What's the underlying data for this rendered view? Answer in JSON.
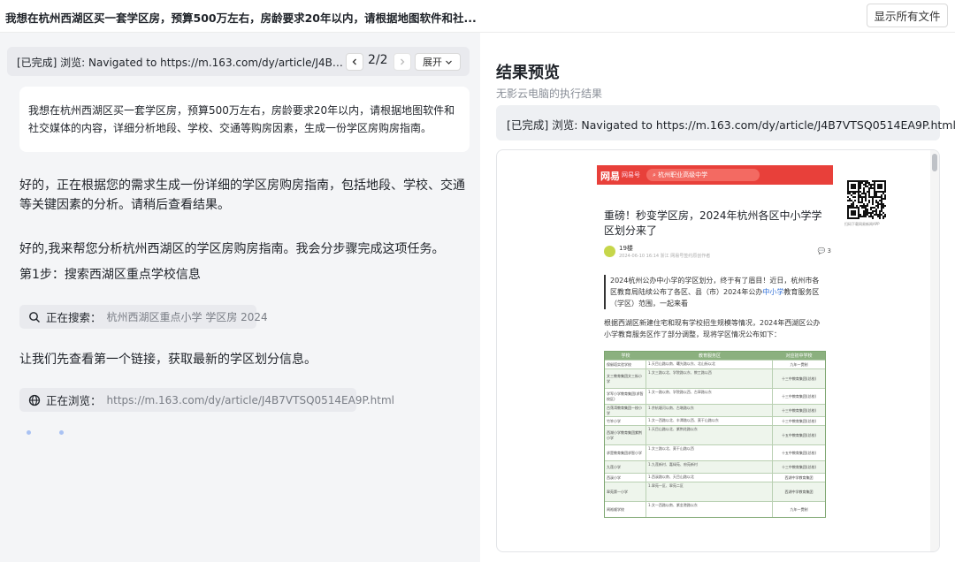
{
  "topbar": {
    "title": "我想在杭州西湖区买一套学区房，预算500万左右，房龄要求20年以内，请根据地图软件和社...",
    "files_button": "显示所有文件"
  },
  "left": {
    "status_text": "[已完成] 浏览: Navigated to https://m.163.com/dy/article/J4B7VTSQ...",
    "page_indicator": "2/2",
    "expand_label": "展开",
    "query": "我想在杭州西湖区买一套学区房，预算500万左右，房龄要求20年以内，请根据地图软件和社交媒体的内容，详细分析地段、学校、交通等购房因素，生成一份学区房购房指南。",
    "messages": [
      "好的，正在根据您的需求生成一份详细的学区房购房指南，包括地段、学校、交通等关键因素的分析。请稍后查看结果。",
      "好的,我来帮您分析杭州西湖区的学区房购房指南。我会分步骤完成这项任务。",
      "第1步：搜索西湖区重点学校信息",
      "让我们先查看第一个链接，获取最新的学区划分信息。"
    ],
    "search_chip": {
      "label": "正在搜索：",
      "value": "杭州西湖区重点小学 学区房 2024"
    },
    "browse_chip": {
      "label": "正在浏览：",
      "value": "https://m.163.com/dy/article/J4B7VTSQ0514EA9P.html"
    }
  },
  "right": {
    "title": "结果预览",
    "subtitle": "无影云电脑的执行结果",
    "status": "[已完成] 浏览: Navigated to https://m.163.com/dy/article/J4B7VTSQ0514EA9P.html",
    "article": {
      "brand": "网易",
      "brand_sub": "网易号",
      "search_placeholder": "杭州职业高级中学",
      "title": "重磅！秒变学区房，2024年杭州各区中小学学区划分来了",
      "author": "19楼",
      "meta": "2024-06-10 16:14  浙江  网易号签约原创作者",
      "comments": "3",
      "para1_a": "2024杭州公办中小学的学区划分，终于有了眉目！近日，杭州市各区教育局陆续公布了各区、县（市）2024年公办",
      "para1_link": "中小学",
      "para1_b": "教育服务区（学区）范围，一起来看",
      "para2": "根据西湖区新建住宅和现有学校招生规模等情况，2024年西湖区公办小学教育服务区作了部分调整，现将学区情况公布如下：",
      "table_headers": [
        "学校",
        "教育服务区",
        "对应初中学校"
      ],
      "table_rows": [
        [
          "保俶塔实验学校",
          "1.天目山路以南、曙光路以东、北山街以北",
          "九年一贯制"
        ],
        [
          "文三教育集团文三街小学",
          "1.文三路以北、学院路以东、教工路以西",
          "十三中教育集团(总校)"
        ],
        [
          "学军小学教育集团(求智校区)",
          "1.文一路以南、学院路以西、古翠路以东",
          "十三中教育集团(总校)"
        ],
        [
          "古荡湾教育集团一校小学",
          "1.余杭塘河以南、古墩路以东",
          "十三中教育集团(总校)"
        ],
        [
          "竹竿小学",
          "1.文一西路以北、丰潭路以西、莫干山路以东",
          "十三中教育集团(总校)"
        ],
        [
          "西湖小学教育集团紫荆小学",
          "1.天目山路以北、紫荆花路以东",
          "十五中教育集团(总校)"
        ],
        [
          "求是教育集团求智小学",
          "1.文三路以北、莫干山路以西",
          "十五中教育集团(总校)"
        ],
        [
          "九莲小学",
          "1.九莲新村、嘉绿苑、府苑新村",
          "十三中教育集团(总校)"
        ],
        [
          "西溪小学",
          "1.西溪路以南、天目山路以北",
          "西湖中学教育集团"
        ],
        [
          "翠苑第一小学",
          "1.翠苑一区、翠苑二区",
          "西湖中学教育集团"
        ],
        [
          "闻裕顺学校",
          "1.文一西路以南、紫金港路以东",
          "九年一贯制"
        ]
      ],
      "qr_caption": "扫码下载网易新闻APP"
    }
  }
}
